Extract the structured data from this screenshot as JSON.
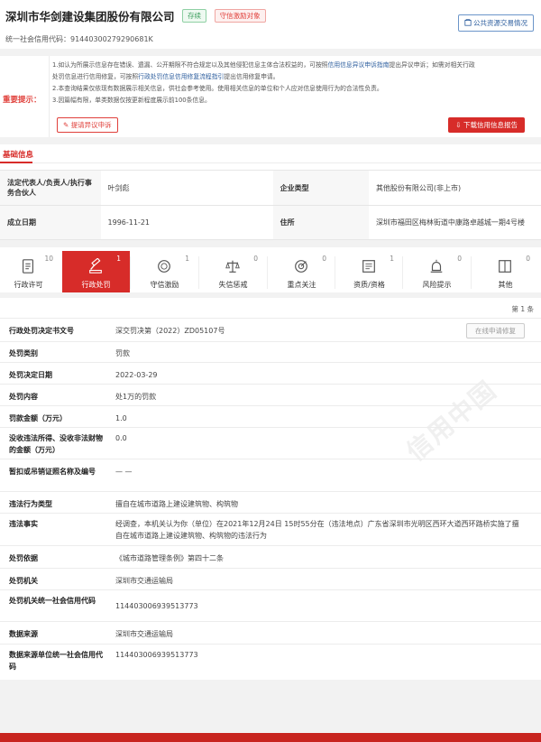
{
  "header": {
    "company_name": "深圳市华剑建设集团股份有限公司",
    "tag_status": "存续",
    "tag_incentive": "守信激励对象",
    "credit_code_label": "统一社会信用代码：",
    "credit_code": "91440300279290681K",
    "public_trade_button": "公共资源交易情况"
  },
  "notice": {
    "label": "重要提示：",
    "line1_a": "1.如认为所展示信息存在错误、遗漏、公开期限不符合规定以及其他侵犯信息主体合法权益的，可按照",
    "line1_link": "信用信息异议申诉指南",
    "line1_b": "提出异议申诉；如需对相关行政",
    "line1_c": "处罚信息进行信用修复，可按照",
    "line1_link2": "行政处罚信息信用修复流程指引",
    "line1_d": "提出信用修复申请。",
    "line2": "2.本查询结果仅依现有数据展示相关信息，供社会参考使用。使用相关信息的单位和个人应对信息使用行为的合法性负责。",
    "line3": "3.因篇幅有限，单类数据仅按更新程度展示前100条信息。",
    "objection_button": "提请异议申诉",
    "download_button": "下载信用信息报告"
  },
  "basic": {
    "section_title": "基础信息",
    "legal_rep_label": "法定代表人/负责人/执行事务合伙人",
    "legal_rep_value": "叶剑彪",
    "enterprise_type_label": "企业类型",
    "enterprise_type_value": "其他股份有限公司(非上市)",
    "founded_label": "成立日期",
    "founded_value": "1996-11-21",
    "address_label": "住所",
    "address_value": "深圳市福田区梅林街道中康路卓越城一期4号楼"
  },
  "tabs": [
    {
      "label": "行政许可",
      "count": "10",
      "icon": "clipboard-icon"
    },
    {
      "label": "行政处罚",
      "count": "1",
      "icon": "gavel-icon"
    },
    {
      "label": "守信激励",
      "count": "1",
      "icon": "medal-icon"
    },
    {
      "label": "失信惩戒",
      "count": "0",
      "icon": "scale-icon"
    },
    {
      "label": "重点关注",
      "count": "0",
      "icon": "target-icon"
    },
    {
      "label": "资质/资格",
      "count": "1",
      "icon": "certificate-icon"
    },
    {
      "label": "风险提示",
      "count": "0",
      "icon": "alarm-icon"
    },
    {
      "label": "其他",
      "count": "0",
      "icon": "book-icon"
    }
  ],
  "detail": {
    "page_count": "第 1 条",
    "repair_button": "在线申请修复",
    "watermark": "信用中国",
    "rows": [
      {
        "label": "行政处罚决定书文号",
        "value": "深交罚决第（2022）ZD05107号"
      },
      {
        "label": "处罚类别",
        "value": "罚款"
      },
      {
        "label": "处罚决定日期",
        "value": "2022-03-29"
      },
      {
        "label": "处罚内容",
        "value": "处1万的罚款"
      },
      {
        "label": "罚款金额（万元）",
        "value": "1.0"
      },
      {
        "label": "没收违法所得、没收非法财物的金额（万元）",
        "value": "0.0"
      },
      {
        "label": "暂扣或吊销证照名称及编号",
        "value": "— —"
      },
      {
        "label": "违法行为类型",
        "value": "擅自在城市道路上建设建筑物、构筑物"
      },
      {
        "label": "违法事实",
        "value": "经调查，本机关认为你（单位）在2021年12月24日 15时55分在（违法地点）广东省深圳市光明区西环大道西环路桥实施了擅自在城市道路上建设建筑物、构筑物的违法行为"
      },
      {
        "label": "处罚依据",
        "value": "《城市道路管理条例》第四十二条"
      },
      {
        "label": "处罚机关",
        "value": "深圳市交通运输局"
      },
      {
        "label": "处罚机关统一社会信用代码",
        "value": "114403006939513773"
      },
      {
        "label": "数据来源",
        "value": "深圳市交通运输局"
      },
      {
        "label": "数据来源单位统一社会信用代码",
        "value": "114403006939513773"
      }
    ]
  },
  "colors": {
    "brand_red": "#d72c29",
    "link_blue": "#2d5e9e",
    "status_green": "#3c9d5d"
  }
}
